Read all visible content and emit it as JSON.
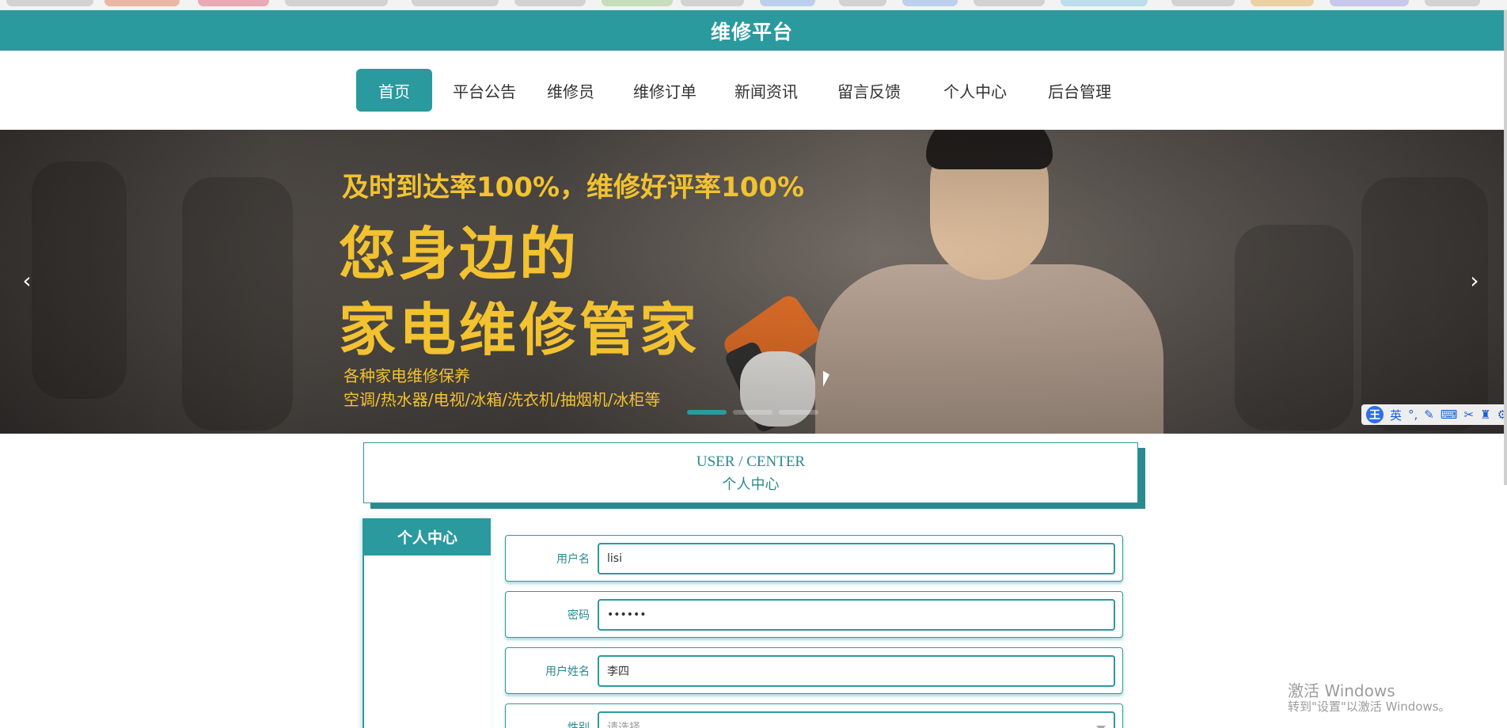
{
  "site": {
    "title": "维修平台"
  },
  "nav": {
    "items": [
      {
        "label": "首页",
        "active": true
      },
      {
        "label": "平台公告",
        "active": false
      },
      {
        "label": "维修员",
        "active": false
      },
      {
        "label": "维修订单",
        "active": false
      },
      {
        "label": "新闻资讯",
        "active": false
      },
      {
        "label": "留言反馈",
        "active": false
      },
      {
        "label": "个人中心",
        "active": false
      },
      {
        "label": "后台管理",
        "active": false
      }
    ]
  },
  "banner": {
    "line1": "及时到达率100%，维修好评率100%",
    "line2": "您身边的",
    "line3": "家电维修管家",
    "line4": "各种家电维修保养",
    "line5": "空调/热水器/电视/冰箱/洗衣机/抽烟机/冰柜等",
    "prev_icon": "chevron-left-icon",
    "next_icon": "chevron-right-icon",
    "slides_total": 3,
    "active_slide": 1
  },
  "ime_toolbar": {
    "logo": "王",
    "mode": "英"
  },
  "section_header": {
    "en": "USER / CENTER",
    "cn": "个人中心"
  },
  "sidebar": {
    "title": "个人中心"
  },
  "form": {
    "fields": [
      {
        "label": "用户名",
        "value": "lisi"
      },
      {
        "label": "密码",
        "value": "••••••"
      },
      {
        "label": "用户姓名",
        "value": "李四"
      },
      {
        "label": "性别",
        "placeholder": "请选择"
      }
    ]
  },
  "watermark": {
    "line1": "激活 Windows",
    "line2": "转到\"设置\"以激活 Windows。"
  },
  "colors": {
    "primary": "#2a9a9f",
    "banner_text": "#f2c230"
  }
}
